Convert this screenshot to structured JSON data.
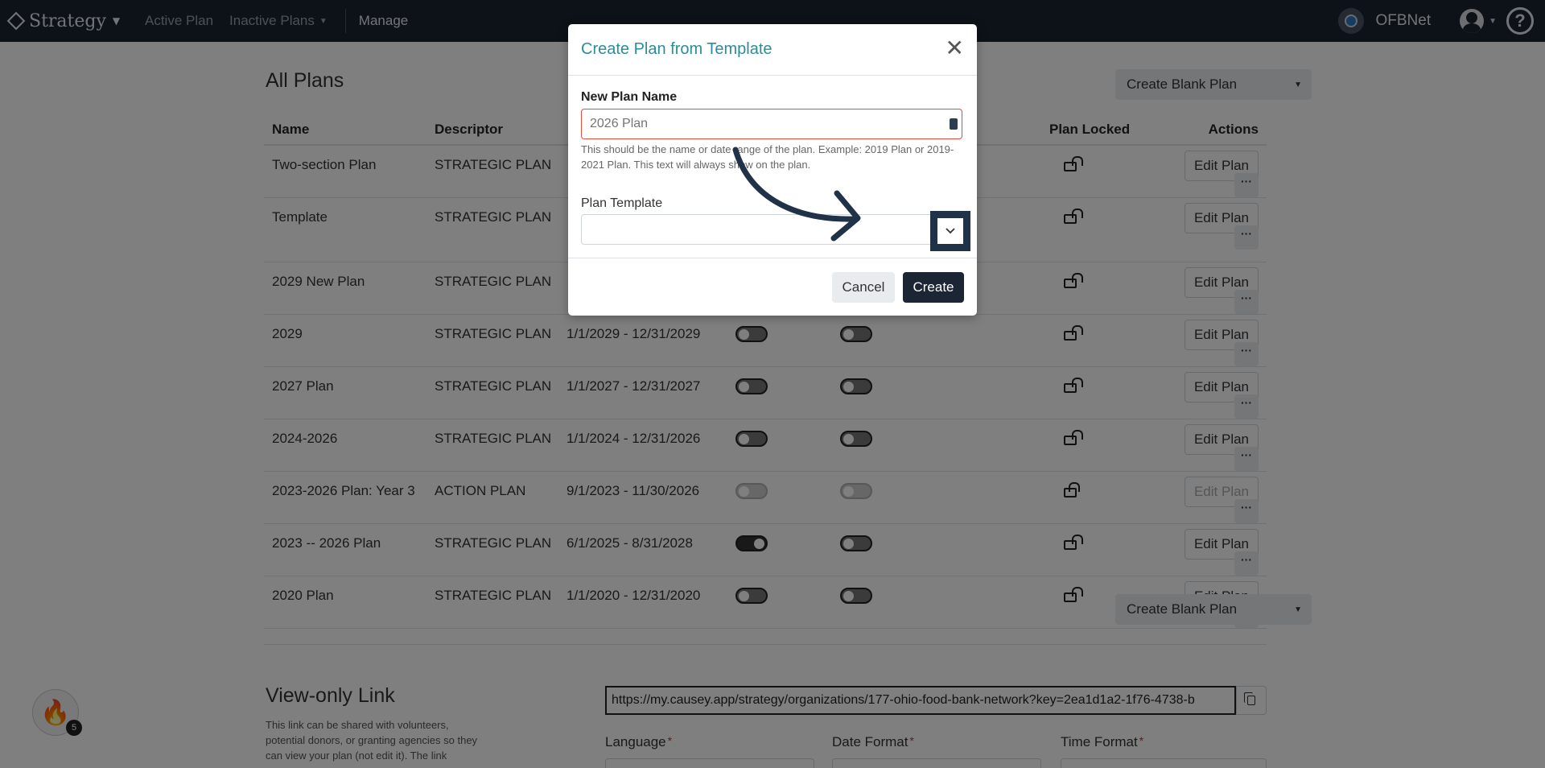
{
  "nav": {
    "brand": "Strategy",
    "links": [
      "Active Plan",
      "Inactive Plans",
      "Manage"
    ],
    "org_name": "OFBNet",
    "help_glyph": "?"
  },
  "page": {
    "title": "All Plans",
    "create_blank_label": "Create Blank Plan"
  },
  "table": {
    "headers": [
      "Name",
      "Descriptor",
      "",
      "",
      "",
      "Plan Locked",
      "Actions"
    ],
    "rows": [
      {
        "name": "Two-section Plan",
        "descriptor": "STRATEGIC PLAN",
        "dates": "",
        "lock": "closed"
      },
      {
        "name": "Template",
        "descriptor": "STRATEGIC PLAN",
        "dates": "",
        "lock": "open"
      },
      {
        "name": "2029 New Plan",
        "descriptor": "STRATEGIC PLAN",
        "dates": "",
        "lock": "open"
      },
      {
        "name": "2029",
        "descriptor": "STRATEGIC PLAN",
        "dates": "1/1/2029 - 12/31/2029",
        "lock": "open"
      },
      {
        "name": "2027 Plan",
        "descriptor": "STRATEGIC PLAN",
        "dates": "1/1/2027 - 12/31/2027",
        "lock": "open"
      },
      {
        "name": "2024-2026",
        "descriptor": "STRATEGIC PLAN",
        "dates": "1/1/2024 - 12/31/2026",
        "lock": "open"
      },
      {
        "name": "2023-2026 Plan: Year 3",
        "descriptor": "ACTION PLAN",
        "dates": "9/1/2023 - 11/30/2026",
        "lock": "closed"
      },
      {
        "name": "2023 -- 2026 Plan",
        "descriptor": "STRATEGIC PLAN",
        "dates": "6/1/2025 - 8/31/2028",
        "lock": "open"
      },
      {
        "name": "2020 Plan",
        "descriptor": "STRATEGIC PLAN",
        "dates": "1/1/2020 - 12/31/2020",
        "lock": "open"
      }
    ],
    "edit_label": "Edit Plan",
    "more_glyph": "···"
  },
  "view_only": {
    "title": "View-only Link",
    "description": "This link can be shared with volunteers, potential donors, or granting agencies so they can view your plan (not edit it). The link",
    "url": "https://my.causey.app/strategy/organizations/177-ohio-food-bank-network?key=2ea1d1a2-1f76-4738-b",
    "language_label": "Language",
    "date_format_label": "Date Format",
    "time_format_label": "Time Format",
    "required_mark": "*"
  },
  "badge_count": "5",
  "modal": {
    "title": "Create Plan from Template",
    "close_glyph": "✕",
    "name_label": "New Plan Name",
    "name_placeholder": "2026 Plan",
    "help_text": "This should be the name or date range of the plan. Example: 2019 Plan or 2019-2021 Plan. This text will always show on the plan.",
    "template_label": "Plan Template",
    "cancel_label": "Cancel",
    "create_label": "Create"
  }
}
